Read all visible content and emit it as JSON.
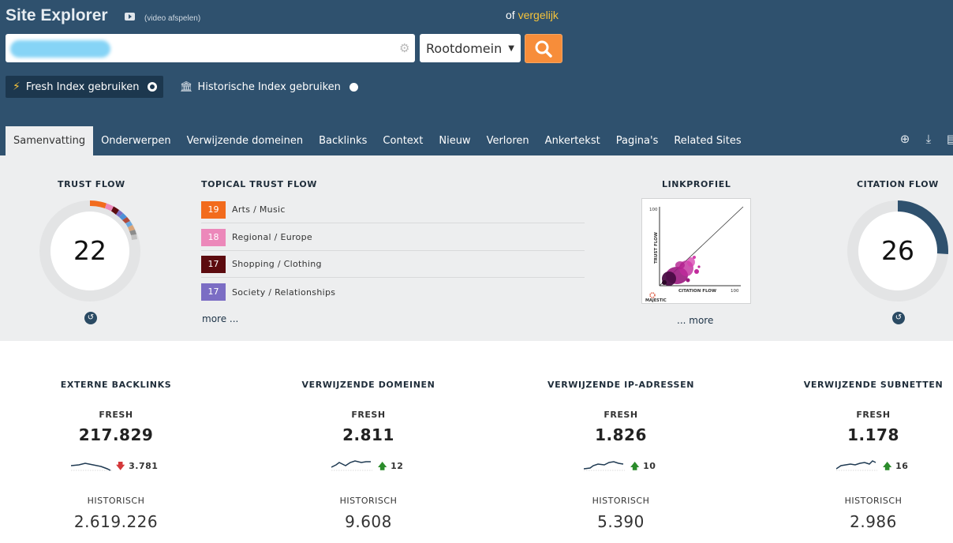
{
  "header": {
    "app_title": "Site Explorer",
    "video_link": "(video afspelen)",
    "compare_prefix": "of",
    "compare_link": "vergelijk",
    "search": {
      "value": "",
      "placeholder": ""
    },
    "scope_select": {
      "selected": "Rootdomein"
    },
    "fresh_index": "Fresh Index gebruiken",
    "historic_index": "Historische Index gebruiken"
  },
  "tabs": [
    "Samenvatting",
    "Onderwerpen",
    "Verwijzende domeinen",
    "Backlinks",
    "Context",
    "Nieuw",
    "Verloren",
    "Ankertekst",
    "Pagina's",
    "Related Sites"
  ],
  "tool_icons": [
    "bookmark-add-icon",
    "download-icon",
    "export-icon"
  ],
  "summary": {
    "trust_flow": {
      "title": "TRUST FLOW",
      "value": "22"
    },
    "topical_trust_flow": {
      "title": "TOPICAL TRUST FLOW",
      "items": [
        {
          "score": "19",
          "label": "Arts / Music",
          "color": "#f26b1d"
        },
        {
          "score": "18",
          "label": "Regional / Europe",
          "color": "#ec88ba"
        },
        {
          "score": "17",
          "label": "Shopping / Clothing",
          "color": "#5c0b0f"
        },
        {
          "score": "17",
          "label": "Society / Relationships",
          "color": "#7b6dc4"
        }
      ],
      "more": "more ..."
    },
    "link_profile": {
      "title": "LINKPROFIEL",
      "more": "... more",
      "y_axis_label": "TRUST FLOW",
      "x_axis_label": "CITATION FLOW",
      "y_max_label": "100",
      "x_max_label": "100",
      "logo_text": "MAJESTIC"
    },
    "citation_flow": {
      "title": "CITATION FLOW",
      "value": "26",
      "fraction": 0.26
    }
  },
  "stats": [
    {
      "title": "EXTERNE BACKLINKS",
      "fresh_label": "FRESH",
      "fresh_value": "217.829",
      "trend": "down",
      "delta": "3.781",
      "historic_label": "HISTORISCH",
      "historic_value": "2.619.226"
    },
    {
      "title": "VERWIJZENDE DOMEINEN",
      "fresh_label": "FRESH",
      "fresh_value": "2.811",
      "trend": "up",
      "delta": "12",
      "historic_label": "HISTORISCH",
      "historic_value": "9.608"
    },
    {
      "title": "VERWIJZENDE IP-ADRESSEN",
      "fresh_label": "FRESH",
      "fresh_value": "1.826",
      "trend": "up",
      "delta": "10",
      "historic_label": "HISTORISCH",
      "historic_value": "5.390"
    },
    {
      "title": "VERWIJZENDE SUBNETTEN",
      "fresh_label": "FRESH",
      "fresh_value": "1.178",
      "trend": "up",
      "delta": "16",
      "historic_label": "HISTORISCH",
      "historic_value": "2.986"
    }
  ]
}
